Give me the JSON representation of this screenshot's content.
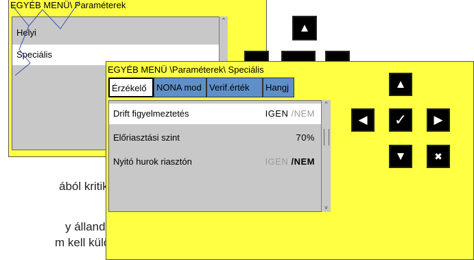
{
  "background": {
    "line1": "ából kritikus",
    "line2": "y   állandó",
    "line3": "m kell külön"
  },
  "back_panel": {
    "title": "EGYÉB MENÜ\\ Paraméterek",
    "items": [
      {
        "label": "Helyi"
      },
      {
        "label": "Speciális"
      }
    ],
    "scroll_up": "^"
  },
  "front_panel": {
    "title": "EGYÉB MENÜ \\Paraméterek\\ Speciális",
    "tabs": [
      {
        "label": "Érzékelő"
      },
      {
        "label": "NONA mod"
      },
      {
        "label": "Verif.érték"
      },
      {
        "label": "Hangj"
      }
    ],
    "rows": [
      {
        "label": "Drift figyelmeztetés",
        "opt_yes": "IGEN",
        "sep": " /",
        "opt_no": "NEM"
      },
      {
        "label": "Előriasztási szint",
        "value": "70%"
      },
      {
        "label": "Nyitó hurok riasztón",
        "opt_yes": "IGEN",
        "sep": " /",
        "opt_no": "NEM"
      }
    ],
    "scroll_up": "^",
    "scroll_down": "v"
  },
  "keypad": {
    "up": "▲",
    "left": "◀",
    "ok": "✓",
    "right": "▶",
    "down": "▼",
    "cancel": "✖"
  },
  "colors": {
    "panel_bg": "#ffff44",
    "tab_bg": "#5f8fc8",
    "list_bg": "#c8c8c8",
    "key_bg": "#000000"
  }
}
